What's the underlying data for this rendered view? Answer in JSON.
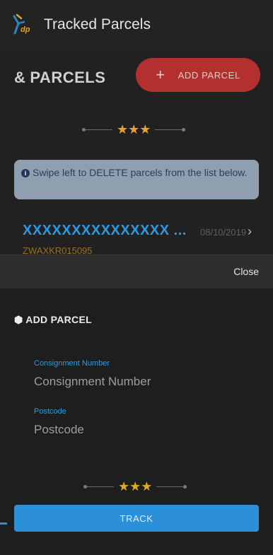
{
  "app": {
    "title": "Tracked Parcels",
    "logo_icon": "dp-courier-logo-icon"
  },
  "parcels": {
    "heading": "PARCELS",
    "heading_icon": "ampersand-icon",
    "add_button_label": "ADD PARCEL",
    "add_button_color": "#b3302e",
    "info_message": "Swipe left to DELETE parcels from the list below.",
    "items": [
      {
        "name": "XXXXXXXXXXXXXXX ...",
        "date": "08/10/2019",
        "consignment": "ZWAXKR015095"
      }
    ]
  },
  "divider": {
    "stars": "★★★"
  },
  "close_label": "Close",
  "add_parcel_sheet": {
    "title": "ADD PARCEL",
    "title_icon": "package-icon",
    "consignment": {
      "label": "Consignment Number",
      "placeholder": "Consignment Number",
      "value": ""
    },
    "postcode": {
      "label": "Postcode",
      "placeholder": "Postcode",
      "value": ""
    },
    "track_label": "TRACK",
    "track_color": "#2b90d8"
  }
}
